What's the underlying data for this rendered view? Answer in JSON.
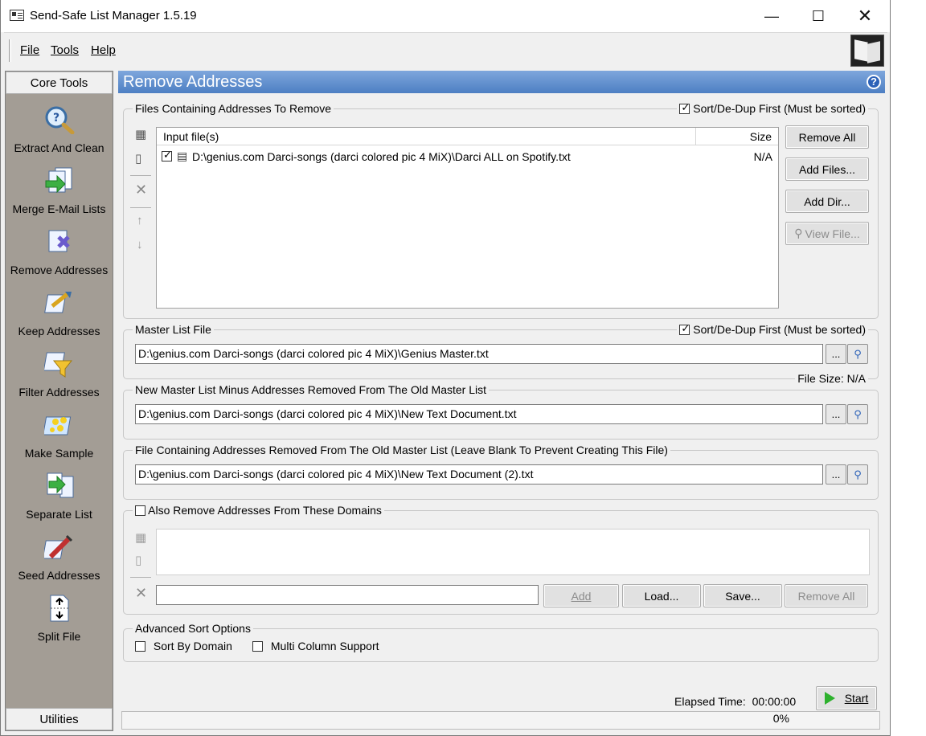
{
  "window": {
    "title": "Send-Safe List Manager 1.5.19"
  },
  "menu": {
    "file": "File",
    "tools": "Tools",
    "help": "Help"
  },
  "sidebar": {
    "top_header": "Core Tools",
    "bottom_header": "Utilities",
    "tools": [
      {
        "label": "Extract And Clean",
        "icon": "magnifier-question-icon"
      },
      {
        "label": "Merge E-Mail Lists",
        "icon": "merge-lists-icon"
      },
      {
        "label": "Remove Addresses",
        "icon": "remove-addresses-icon"
      },
      {
        "label": "Keep Addresses",
        "icon": "keep-addresses-icon"
      },
      {
        "label": "Filter Addresses",
        "icon": "filter-funnel-icon"
      },
      {
        "label": "Make Sample",
        "icon": "sample-icon"
      },
      {
        "label": "Separate List",
        "icon": "separate-list-icon"
      },
      {
        "label": "Seed Addresses",
        "icon": "syringe-icon"
      },
      {
        "label": "Split File",
        "icon": "split-file-icon"
      }
    ]
  },
  "main": {
    "header": "Remove Addresses",
    "files_group": {
      "title": "Files Containing Addresses To Remove",
      "sort_label": "Sort/De-Dup First (Must be sorted)",
      "col_input": "Input file(s)",
      "col_size": "Size",
      "rows": [
        {
          "path": "D:\\genius.com Darci-songs (darci colored pic 4 MiX)\\Darci ALL on Spotify.txt",
          "size": "N/A"
        }
      ],
      "remove_all": "Remove All",
      "add_files": "Add Files...",
      "add_dir": "Add Dir...",
      "view_file": "View File..."
    },
    "master_group": {
      "title": "Master List File",
      "sort_label": "Sort/De-Dup First (Must be sorted)",
      "path": "D:\\genius.com Darci-songs (darci colored pic 4 MiX)\\Genius Master.txt",
      "browse": "...",
      "file_size": "File Size: N/A"
    },
    "new_master_group": {
      "title": "New Master List Minus Addresses Removed From The Old Master List",
      "path": "D:\\genius.com Darci-songs (darci colored pic 4 MiX)\\New Text Document.txt",
      "browse": "..."
    },
    "removed_group": {
      "title": "File Containing Addresses Removed From The Old Master List (Leave Blank To Prevent Creating This File)",
      "path": "D:\\genius.com Darci-songs (darci colored pic 4 MiX)\\New Text Document (2).txt",
      "browse": "..."
    },
    "domains_group": {
      "title": "Also Remove Addresses From These Domains",
      "input_value": "",
      "add": "Add",
      "load": "Load...",
      "save": "Save...",
      "remove_all": "Remove All"
    },
    "advanced_group": {
      "title": "Advanced Sort Options",
      "sort_by_domain": "Sort By Domain",
      "multi_column": "Multi Column Support"
    },
    "elapsed_label": "Elapsed Time:",
    "elapsed_value": "00:00:00",
    "start": "Start",
    "progress": "0%"
  }
}
